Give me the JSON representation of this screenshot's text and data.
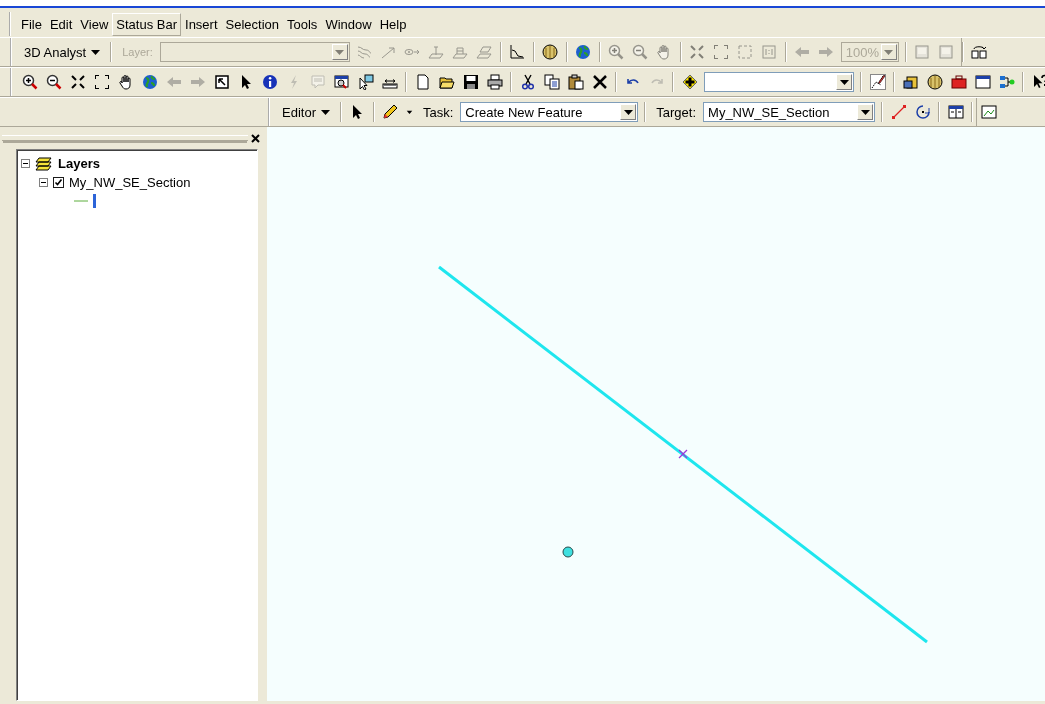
{
  "menu": [
    {
      "label": "File",
      "selected": false
    },
    {
      "label": "Edit",
      "selected": false
    },
    {
      "label": "View",
      "selected": false
    },
    {
      "label": "Status Bar",
      "selected": true
    },
    {
      "label": "Insert",
      "selected": false
    },
    {
      "label": "Selection",
      "selected": false
    },
    {
      "label": "Tools",
      "selected": false
    },
    {
      "label": "Window",
      "selected": false
    },
    {
      "label": "Help",
      "selected": false
    }
  ],
  "toolbars": [
    {
      "items": [
        {
          "kind": "dropdown",
          "label": "3D Analyst"
        },
        {
          "kind": "separator"
        },
        {
          "kind": "label",
          "text": "Layer:",
          "disabled": true
        },
        {
          "kind": "layer-combo",
          "disabled": true
        },
        {
          "kind": "contour",
          "disabled": true
        },
        {
          "kind": "slope",
          "disabled": true
        },
        {
          "kind": "sight",
          "disabled": true
        },
        {
          "kind": "surface-point",
          "disabled": true
        },
        {
          "kind": "surface-area",
          "disabled": true
        },
        {
          "kind": "surface-volume",
          "disabled": true
        },
        {
          "kind": "separator"
        },
        {
          "kind": "graph",
          "disabled": false
        },
        {
          "kind": "separator"
        },
        {
          "kind": "sphere",
          "disabled": false
        },
        {
          "kind": "separator"
        },
        {
          "kind": "globe",
          "disabled": false
        },
        {
          "kind": "separator"
        },
        {
          "kind": "zoom-in",
          "disabled": true
        },
        {
          "kind": "zoom-out",
          "disabled": true
        },
        {
          "kind": "hand",
          "disabled": true
        },
        {
          "kind": "separator"
        },
        {
          "kind": "fixed-in",
          "disabled": true
        },
        {
          "kind": "fixed-out",
          "disabled": true
        },
        {
          "kind": "frame",
          "disabled": true
        },
        {
          "kind": "one-to-one",
          "disabled": true
        },
        {
          "kind": "separator"
        },
        {
          "kind": "back",
          "disabled": true
        },
        {
          "kind": "forward",
          "disabled": true
        },
        {
          "kind": "zoom-combo",
          "value": "100%",
          "disabled": true
        },
        {
          "kind": "separator"
        },
        {
          "kind": "page",
          "disabled": true
        },
        {
          "kind": "page",
          "disabled": true
        },
        {
          "kind": "separator"
        },
        {
          "kind": "swap",
          "disabled": false
        }
      ]
    },
    {
      "items": [
        {
          "kind": "zoom-in",
          "disabled": false
        },
        {
          "kind": "zoom-out",
          "disabled": false
        },
        {
          "kind": "fixed-in",
          "disabled": false
        },
        {
          "kind": "fixed-out",
          "disabled": false
        },
        {
          "kind": "hand",
          "disabled": false
        },
        {
          "kind": "globe",
          "disabled": false
        },
        {
          "kind": "back",
          "disabled": true
        },
        {
          "kind": "forward",
          "disabled": true
        },
        {
          "kind": "select-box",
          "disabled": false
        },
        {
          "kind": "pointer",
          "disabled": false
        },
        {
          "kind": "info",
          "disabled": false
        },
        {
          "kind": "lightning",
          "disabled": true
        },
        {
          "kind": "popup",
          "disabled": true
        },
        {
          "kind": "find",
          "disabled": false
        },
        {
          "kind": "select-pointer",
          "disabled": false
        },
        {
          "kind": "measure",
          "disabled": false
        },
        {
          "kind": "separator"
        },
        {
          "kind": "new",
          "disabled": false
        },
        {
          "kind": "open",
          "disabled": false
        },
        {
          "kind": "save",
          "disabled": false
        },
        {
          "kind": "print",
          "disabled": false
        },
        {
          "kind": "separator"
        },
        {
          "kind": "cut",
          "disabled": false
        },
        {
          "kind": "copy",
          "disabled": false
        },
        {
          "kind": "paste",
          "disabled": false
        },
        {
          "kind": "delete",
          "disabled": false
        },
        {
          "kind": "separator"
        },
        {
          "kind": "undo",
          "disabled": false
        },
        {
          "kind": "redo",
          "disabled": true
        },
        {
          "kind": "separator"
        },
        {
          "kind": "add-data",
          "disabled": false
        },
        {
          "kind": "scale-combo",
          "disabled": false
        },
        {
          "kind": "separator"
        },
        {
          "kind": "sketch-edit",
          "disabled": false
        },
        {
          "kind": "separator"
        },
        {
          "kind": "cabinet",
          "disabled": false
        },
        {
          "kind": "sphere",
          "disabled": false
        },
        {
          "kind": "toolbox",
          "disabled": false
        },
        {
          "kind": "window",
          "disabled": false
        },
        {
          "kind": "flow",
          "disabled": false
        },
        {
          "kind": "separator"
        },
        {
          "kind": "help",
          "disabled": false
        }
      ]
    },
    {
      "items": [
        {
          "kind": "dropdown",
          "label": "Editor"
        },
        {
          "kind": "separator"
        },
        {
          "kind": "pointer",
          "disabled": false
        },
        {
          "kind": "separator"
        },
        {
          "kind": "pencil",
          "disabled": false
        },
        {
          "kind": "caret-button",
          "disabled": false
        },
        {
          "kind": "label",
          "text": "Task:",
          "disabled": false
        },
        {
          "kind": "task-combo",
          "value": "Create New Feature",
          "disabled": false
        },
        {
          "kind": "separator"
        },
        {
          "kind": "label",
          "text": "Target:",
          "disabled": false
        },
        {
          "kind": "target-combo",
          "value": "My_NW_SE_Section",
          "disabled": false
        },
        {
          "kind": "separator"
        },
        {
          "kind": "sketch-line",
          "disabled": false
        },
        {
          "kind": "rotate",
          "disabled": false
        },
        {
          "kind": "separator"
        },
        {
          "kind": "table-window",
          "disabled": false
        },
        {
          "kind": "separator"
        },
        {
          "kind": "chart-window",
          "disabled": false
        }
      ]
    }
  ],
  "toc": {
    "title": "Layers",
    "expanded": true,
    "children": [
      {
        "label": "My_NW_SE_Section",
        "checked": true,
        "expanded": true
      }
    ]
  }
}
